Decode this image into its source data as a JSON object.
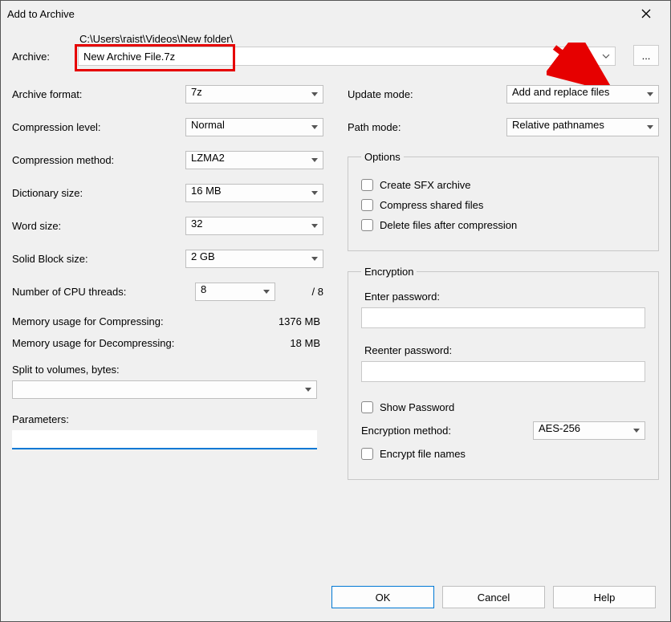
{
  "window": {
    "title": "Add to Archive"
  },
  "archive": {
    "label": "Archive:",
    "path": "C:\\Users\\raist\\Videos\\New folder\\",
    "filename": "New Archive File.7z",
    "browse": "..."
  },
  "left": {
    "format_label": "Archive format:",
    "format_value": "7z",
    "level_label": "Compression level:",
    "level_value": "Normal",
    "method_label": "Compression method:",
    "method_value": "LZMA2",
    "dict_label": "Dictionary size:",
    "dict_value": "16 MB",
    "word_label": "Word size:",
    "word_value": "32",
    "solid_label": "Solid Block size:",
    "solid_value": "2 GB",
    "threads_label": "Number of CPU threads:",
    "threads_value": "8",
    "threads_total": "/ 8",
    "mem_comp_label": "Memory usage for Compressing:",
    "mem_comp_value": "1376 MB",
    "mem_decomp_label": "Memory usage for Decompressing:",
    "mem_decomp_value": "18 MB",
    "split_label": "Split to volumes, bytes:",
    "split_value": "",
    "params_label": "Parameters:",
    "params_value": ""
  },
  "right": {
    "update_label": "Update mode:",
    "update_value": "Add and replace files",
    "path_label": "Path mode:",
    "path_value": "Relative pathnames",
    "options_legend": "Options",
    "opt_sfx": "Create SFX archive",
    "opt_shared": "Compress shared files",
    "opt_delete": "Delete files after compression",
    "enc_legend": "Encryption",
    "enc_enter": "Enter password:",
    "enc_reenter": "Reenter password:",
    "enc_show": "Show Password",
    "enc_method_label": "Encryption method:",
    "enc_method_value": "AES-256",
    "enc_names": "Encrypt file names"
  },
  "buttons": {
    "ok": "OK",
    "cancel": "Cancel",
    "help": "Help"
  }
}
